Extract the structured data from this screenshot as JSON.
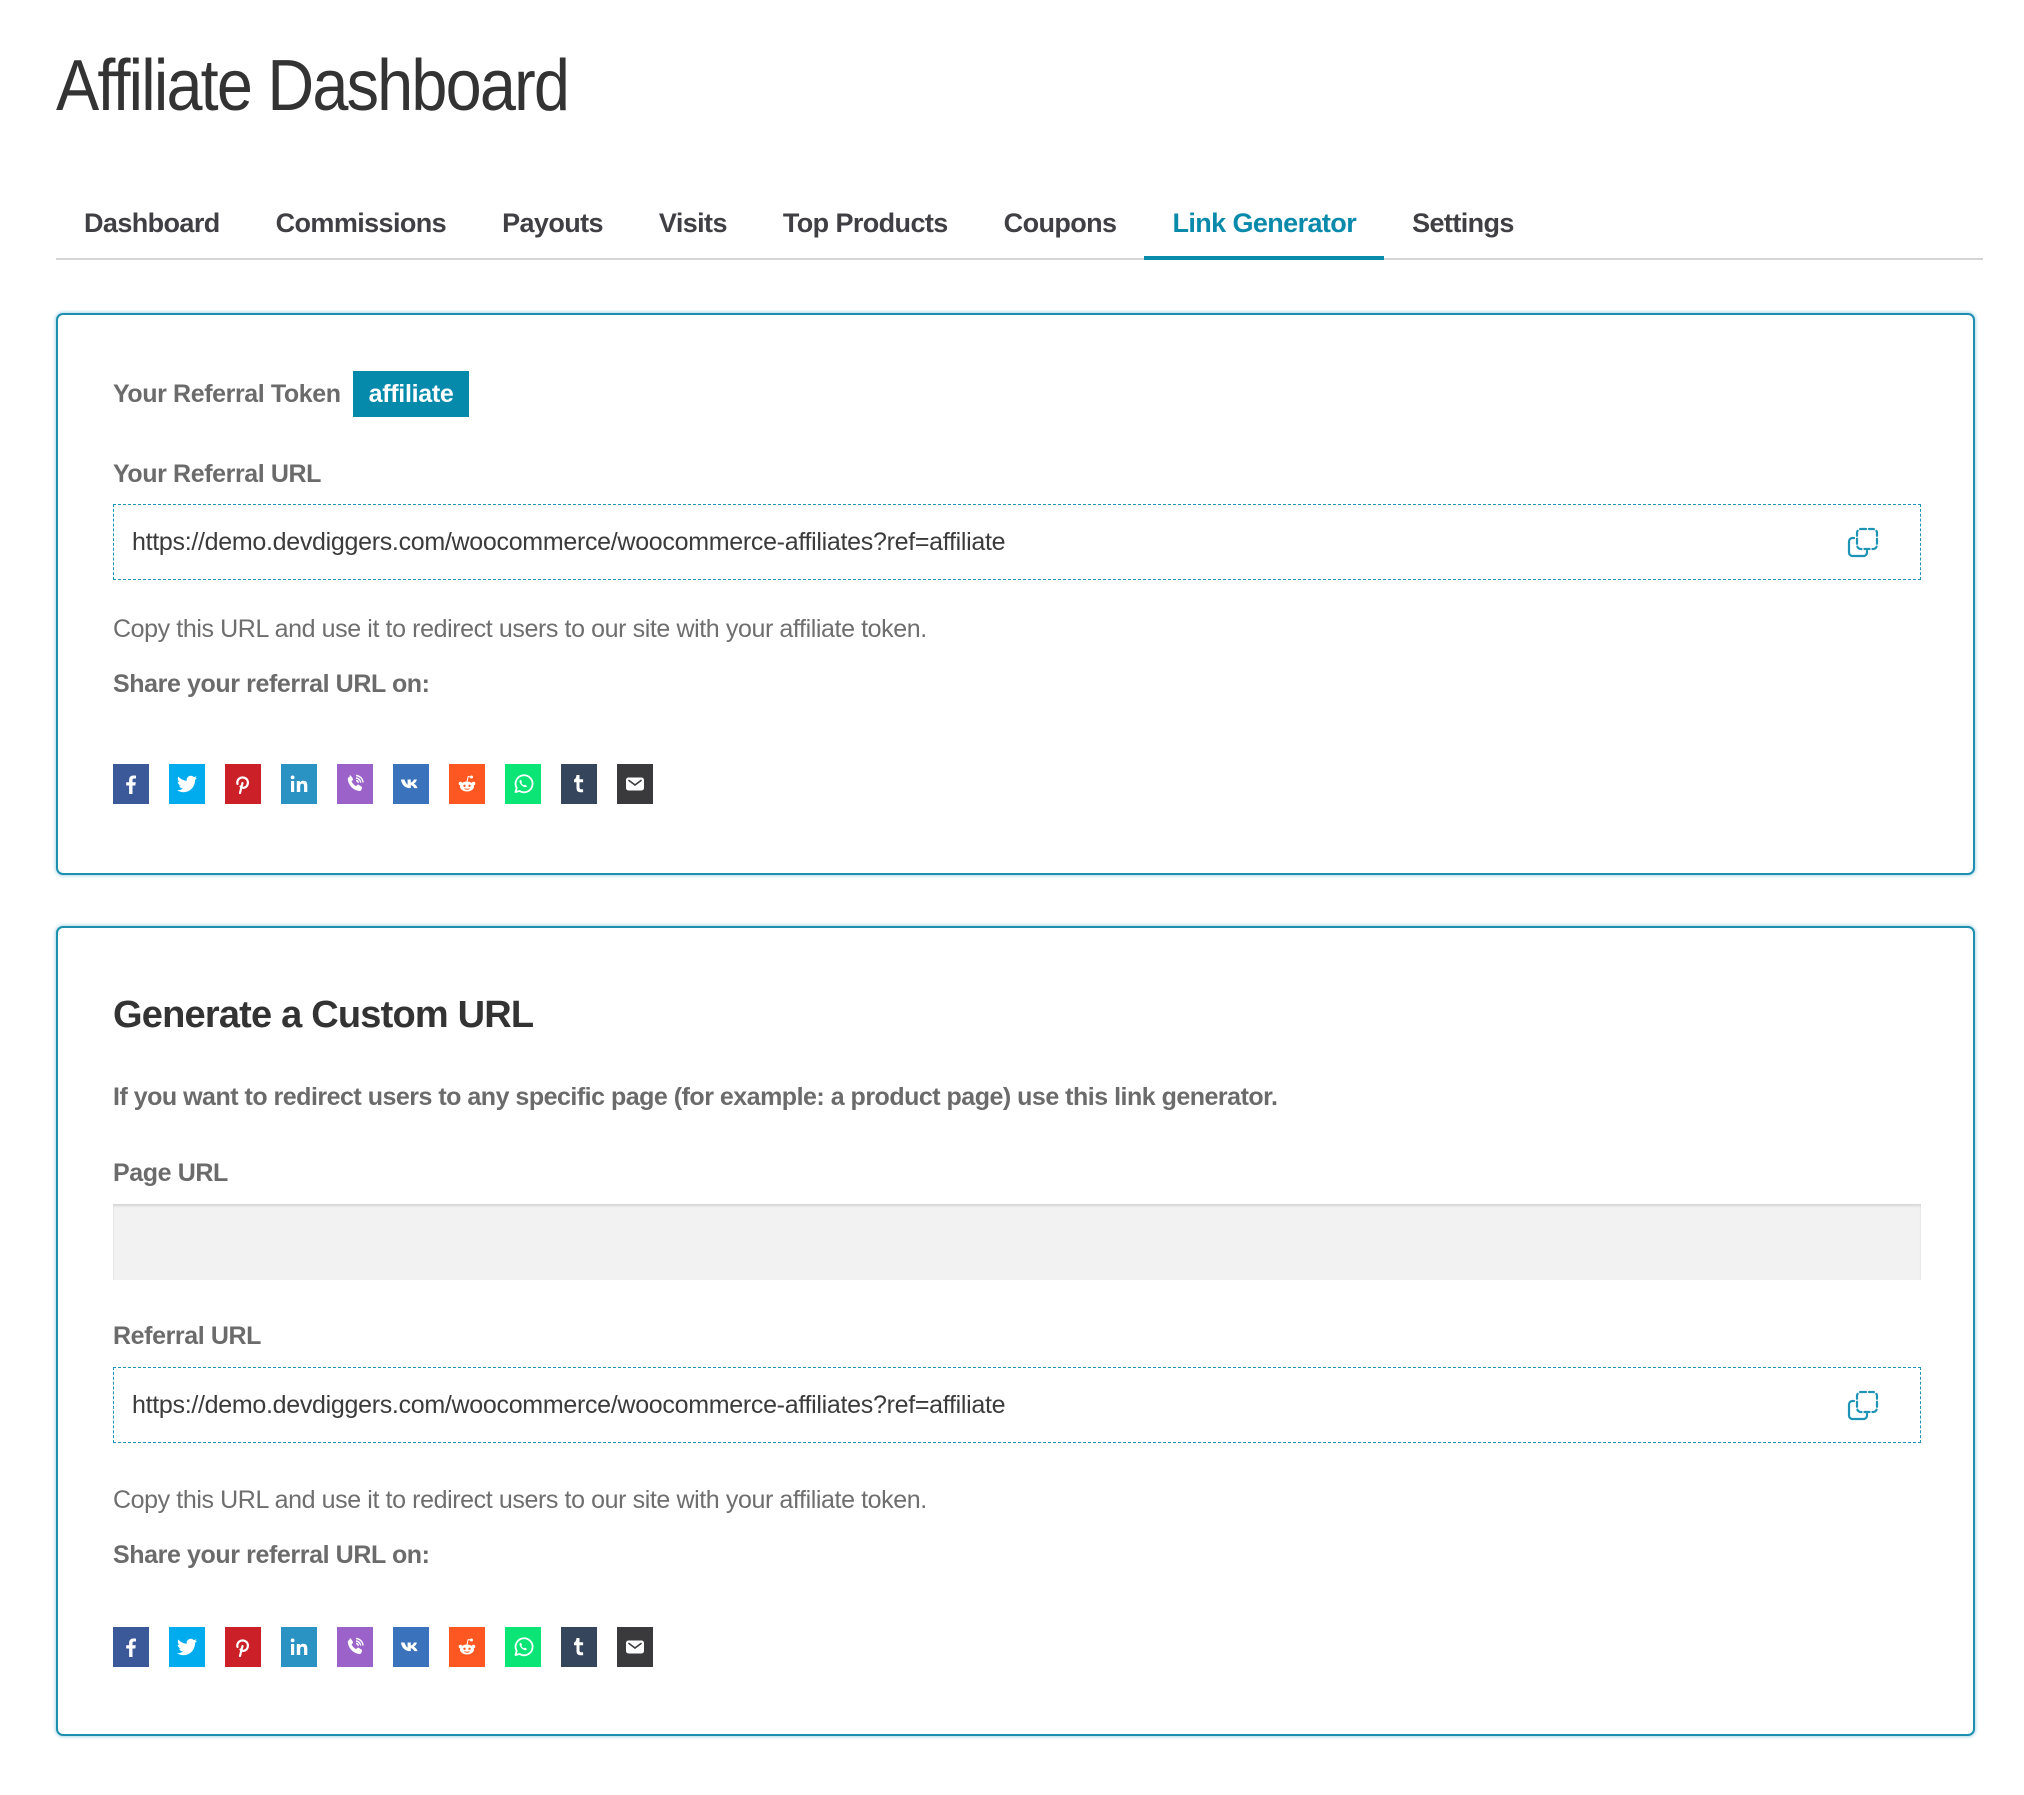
{
  "page": {
    "title": "Affiliate Dashboard"
  },
  "tabs": [
    {
      "label": "Dashboard",
      "active": false
    },
    {
      "label": "Commissions",
      "active": false
    },
    {
      "label": "Payouts",
      "active": false
    },
    {
      "label": "Visits",
      "active": false
    },
    {
      "label": "Top Products",
      "active": false
    },
    {
      "label": "Coupons",
      "active": false
    },
    {
      "label": "Link Generator",
      "active": true
    },
    {
      "label": "Settings",
      "active": false
    }
  ],
  "colors": {
    "accent": "#068aab",
    "card_border": "#1f8fb0",
    "label": "#6b6b6b"
  },
  "referral": {
    "token_label": "Your Referral Token",
    "token_value": "affiliate",
    "url_label": "Your Referral URL",
    "url_value": "https://demo.devdiggers.com/woocommerce/woocommerce-affiliates?ref=affiliate",
    "copy_icon": "copy-icon",
    "help_text": "Copy this URL and use it to redirect users to our site with your affiliate token.",
    "share_label": "Share your referral URL on:"
  },
  "custom": {
    "title": "Generate a Custom URL",
    "description": "If you want to redirect users to any specific page (for example: a product page) use this link generator.",
    "page_url_label": "Page URL",
    "page_url_value": "",
    "page_url_placeholder": "",
    "referral_url_label": "Referral URL",
    "referral_url_value": "https://demo.devdiggers.com/woocommerce/woocommerce-affiliates?ref=affiliate",
    "copy_icon": "copy-icon",
    "help_text": "Copy this URL and use it to redirect users to our site with your affiliate token.",
    "share_label": "Share your referral URL on:"
  },
  "social": [
    {
      "name": "facebook",
      "icon": "facebook-icon",
      "color": "#3b5998"
    },
    {
      "name": "twitter",
      "icon": "twitter-icon",
      "color": "#00aced"
    },
    {
      "name": "pinterest",
      "icon": "pinterest-icon",
      "color": "#cb2027"
    },
    {
      "name": "linkedin",
      "icon": "linkedin-icon",
      "color": "#2a93c4"
    },
    {
      "name": "viber",
      "icon": "viber-icon",
      "color": "#9b63c9"
    },
    {
      "name": "vk",
      "icon": "vk-icon",
      "color": "#3a72bb"
    },
    {
      "name": "reddit",
      "icon": "reddit-icon",
      "color": "#ff5722"
    },
    {
      "name": "whatsapp",
      "icon": "whatsapp-icon",
      "color": "#0ae575"
    },
    {
      "name": "tumblr",
      "icon": "tumblr-icon",
      "color": "#35465c"
    },
    {
      "name": "email",
      "icon": "email-icon",
      "color": "#3a3a3d"
    }
  ]
}
